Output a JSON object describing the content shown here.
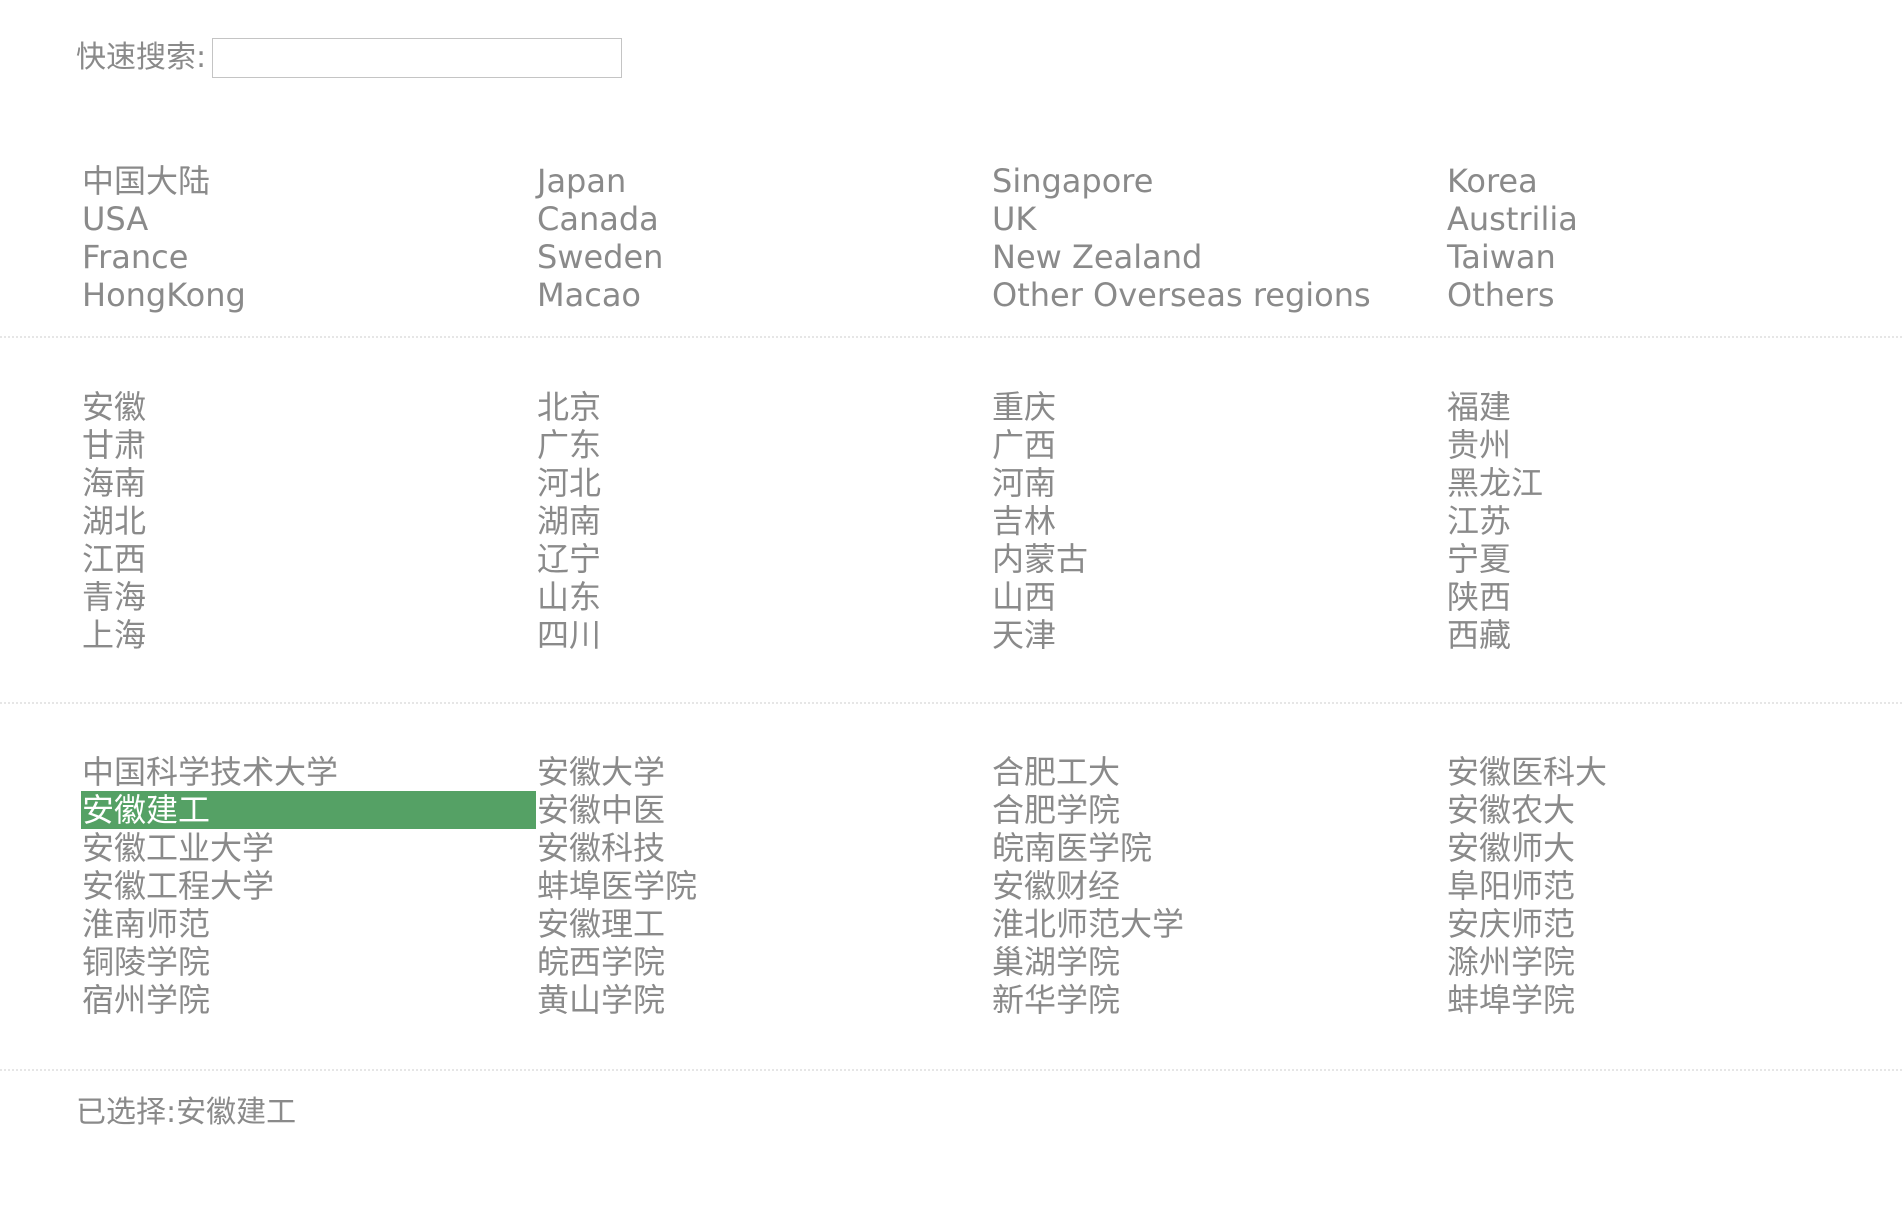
{
  "search": {
    "label": "快速搜索:",
    "value": "",
    "placeholder": ""
  },
  "regions": [
    "中国大陆",
    "Japan",
    "Singapore",
    "Korea",
    "USA",
    "Canada",
    "UK",
    "Austrilia",
    "France",
    "Sweden",
    "New Zealand",
    "Taiwan",
    "HongKong",
    "Macao",
    "Other Overseas regions",
    "Others"
  ],
  "provinces": [
    "安徽",
    "北京",
    "重庆",
    "福建",
    "甘肃",
    "广东",
    "广西",
    "贵州",
    "海南",
    "河北",
    "河南",
    "黑龙江",
    "湖北",
    "湖南",
    "吉林",
    "江苏",
    "江西",
    "辽宁",
    "内蒙古",
    "宁夏",
    "青海",
    "山东",
    "山西",
    "陕西",
    "上海",
    "四川",
    "天津",
    "西藏"
  ],
  "schools": [
    "中国科学技术大学",
    "安徽大学",
    "合肥工大",
    "安徽医科大",
    "安徽建工",
    "安徽中医",
    "合肥学院",
    "安徽农大",
    "安徽工业大学",
    "安徽科技",
    "皖南医学院",
    "安徽师大",
    "安徽工程大学",
    "蚌埠医学院",
    "安徽财经",
    "阜阳师范",
    "淮南师范",
    "安徽理工",
    "淮北师范大学",
    "安庆师范",
    "铜陵学院",
    "皖西学院",
    "巢湖学院",
    "滁州学院",
    "宿州学院",
    "黄山学院",
    "新华学院",
    "蚌埠学院"
  ],
  "selected_school": "安徽建工",
  "selection": {
    "label": "已选择:",
    "value": "安徽建工"
  },
  "colors": {
    "text": "#8a8a8a",
    "selected_bg": "#55a165",
    "selected_text": "#ffffff",
    "divider": "#e6e6e6",
    "input_border": "#c4c4c4"
  }
}
